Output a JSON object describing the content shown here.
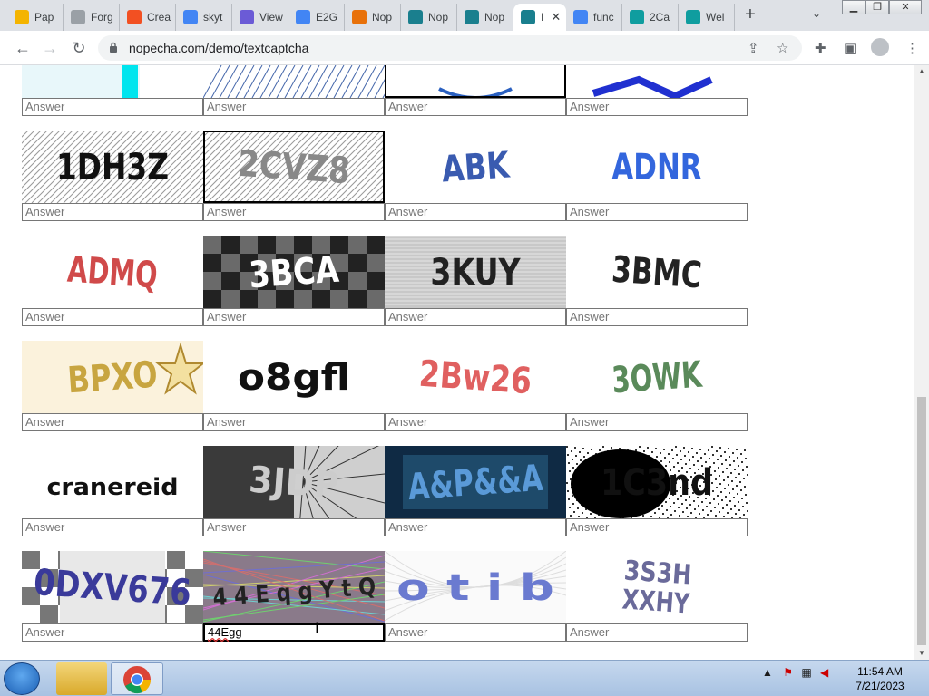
{
  "browser": {
    "tabs": [
      {
        "label": "Pap",
        "fav": "#f4b400",
        "icon": "pen-icon"
      },
      {
        "label": "Forg",
        "fav": "#9aa0a6",
        "icon": "infinity-icon"
      },
      {
        "label": "Crea",
        "fav": "#f25022",
        "icon": "microsoft-icon"
      },
      {
        "label": "skyt",
        "fav": "#4285f4",
        "icon": "google-icon"
      },
      {
        "label": "View",
        "fav": "#6b5bd6",
        "icon": "at-icon"
      },
      {
        "label": "E2G",
        "fav": "#4285f4",
        "icon": "google-icon"
      },
      {
        "label": "Nop",
        "fav": "#e8710a",
        "icon": "page-icon"
      },
      {
        "label": "Nop",
        "fav": "#1a7f8e",
        "icon": "robot-icon"
      },
      {
        "label": "Nop",
        "fav": "#1a7f8e",
        "icon": "robot-icon"
      },
      {
        "label": "I",
        "fav": "#1a7f8e",
        "icon": "robot-icon",
        "active": true
      },
      {
        "label": "func",
        "fav": "#4285f4",
        "icon": "google-icon"
      },
      {
        "label": "2Ca",
        "fav": "#0f9d9f",
        "icon": "openai-icon"
      },
      {
        "label": "Wel",
        "fav": "#0f9d9f",
        "icon": "openai-icon"
      }
    ],
    "url": "nopecha.com/demo/textcaptcha"
  },
  "captcha": {
    "answer_placeholder": "Answer",
    "rows": [
      [
        {
          "text": "",
          "style": "a"
        },
        {
          "text": "",
          "style": "b"
        },
        {
          "text": "",
          "style": "c",
          "sel": true
        },
        {
          "text": "",
          "style": "d"
        }
      ],
      [
        {
          "text": "1DH3Z",
          "style": "hatch",
          "color": "#111"
        },
        {
          "text": "2CVZ8",
          "style": "hatch2",
          "color": "#888",
          "sel": true
        },
        {
          "text": "ABK",
          "style": "plain",
          "color": "#3a5bb0"
        },
        {
          "text": "ADNR",
          "style": "plain",
          "color": "#3366dd"
        }
      ],
      [
        {
          "text": "ADMQ",
          "style": "plain",
          "color": "#d04a4a"
        },
        {
          "text": "3BCA",
          "style": "checker",
          "color": "#fff"
        },
        {
          "text": "3KUY",
          "style": "dots",
          "color": "#222"
        },
        {
          "text": "3BMC",
          "style": "plain",
          "color": "#222"
        }
      ],
      [
        {
          "text": "BPXO",
          "style": "cream",
          "color": "#c8a540"
        },
        {
          "text": "o8gfl",
          "style": "plain",
          "color": "#111"
        },
        {
          "text": "2Bw26",
          "style": "plain",
          "color": "#e06060"
        },
        {
          "text": "3OWK",
          "style": "plain",
          "color": "#5a8a5a"
        }
      ],
      [
        {
          "text": "cranereid",
          "style": "plain",
          "color": "#111"
        },
        {
          "text": "3JDP",
          "style": "rays",
          "color": "#ccc"
        },
        {
          "text": "A&P&&A",
          "style": "navy",
          "color": "#5a9ad8"
        },
        {
          "text": "1C3nd",
          "style": "noise",
          "color": "#111"
        }
      ],
      [
        {
          "text": "0DXV676",
          "style": "bigcheck",
          "color": "#3a3a9a"
        },
        {
          "text": "4 4 E q g Y t Q",
          "style": "lines",
          "color": "#222"
        },
        {
          "text": "o t i b",
          "style": "light",
          "color": "#6a7ad0"
        },
        {
          "text": "3S3H XXHY",
          "style": "plain",
          "color": "#6a6a9a"
        }
      ]
    ],
    "focused_value": "44Egg"
  },
  "taskbar": {
    "time": "11:54 AM",
    "date": "7/21/2023"
  }
}
